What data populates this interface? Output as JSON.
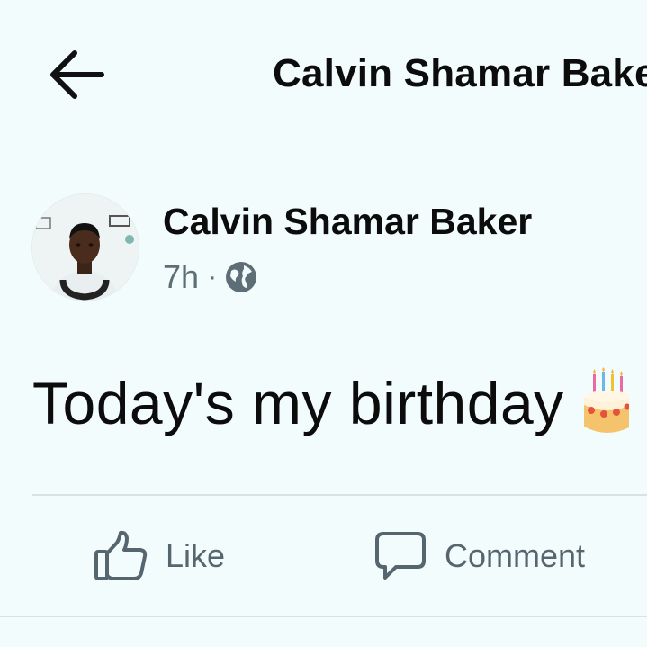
{
  "header": {
    "back_icon": "arrow-left-icon",
    "title": "Calvin Shamar Baker"
  },
  "post": {
    "author_name": "Calvin Shamar Baker",
    "time": "7h",
    "separator": "·",
    "privacy_icon": "globe-icon",
    "text": "Today's my birthday",
    "emoji_icon": "birthday-cake-icon"
  },
  "actions": {
    "like_label": "Like",
    "like_icon": "thumbs-up-icon",
    "comment_label": "Comment",
    "comment_icon": "speech-bubble-icon"
  },
  "colors": {
    "background": "#f3fcfd",
    "text_primary": "#0c0c0c",
    "text_secondary": "#5e6e76",
    "divider": "#d9e1e4"
  }
}
